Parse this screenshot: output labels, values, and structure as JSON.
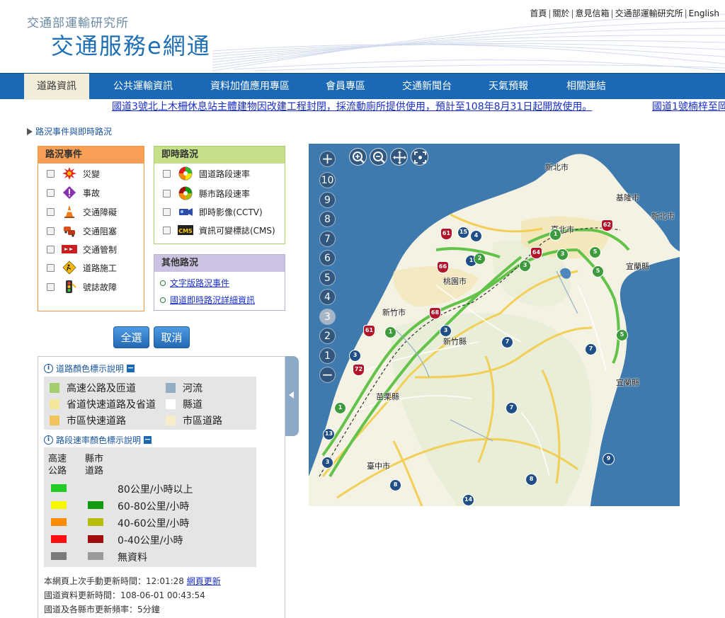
{
  "header": {
    "org_name": "交通部運輸研究所",
    "site_title": "交通服務e網通",
    "top_links": [
      "首頁",
      "關於",
      "意見信箱",
      "交通部運輸研究所",
      "English"
    ]
  },
  "nav": {
    "items": [
      "道路資訊",
      "公共運輸資訊",
      "資料加值應用專區",
      "會員專區",
      "交通新聞台",
      "天氣預報",
      "相關連結"
    ],
    "active": "道路資訊"
  },
  "marquee": {
    "items": [
      "國道3號北上木柵休息站主體建物因改建工程封閉，採流動廁所提供使用，預計至108年8月31日起開放使用。",
      "國道1號楠梓至岡"
    ]
  },
  "breadcrumb": "路況事件與即時路況",
  "incidents_panel": {
    "title": "路況事件",
    "items": [
      {
        "label": "災變",
        "icon": "disaster-icon"
      },
      {
        "label": "事故",
        "icon": "accident-icon"
      },
      {
        "label": "交通障礙",
        "icon": "traffic-cone-icon"
      },
      {
        "label": "交通阻塞",
        "icon": "congestion-icon"
      },
      {
        "label": "交通管制",
        "icon": "traffic-control-icon"
      },
      {
        "label": "道路施工",
        "icon": "road-work-icon"
      },
      {
        "label": "號誌故障",
        "icon": "signal-fault-icon"
      }
    ]
  },
  "realtime_panel": {
    "title": "即時路況",
    "items": [
      {
        "label": "國道路段速率",
        "icon": "freeway-speed-icon"
      },
      {
        "label": "縣市路段速率",
        "icon": "city-speed-icon"
      },
      {
        "label": "即時影像(CCTV)",
        "icon": "cctv-icon"
      },
      {
        "label": "資訊可變標誌(CMS)",
        "icon": "cms-icon",
        "icon_text": "CMS"
      }
    ]
  },
  "other_panel": {
    "title": "其他路況",
    "links": [
      "文字版路況事件",
      "國道即時路況詳細資訊"
    ]
  },
  "buttons": {
    "select_all": "全選",
    "cancel": "取消"
  },
  "road_color_legend": {
    "title": "道路顏色標示說明",
    "items": [
      {
        "label": "高速公路及匝道",
        "color": "#a4cd6e"
      },
      {
        "label": "河流",
        "color": "#93aec2"
      },
      {
        "label": "省道快速道路及省道",
        "color": "#f2e79a"
      },
      {
        "label": "縣道",
        "color": "#ffffff"
      },
      {
        "label": "市區快速道路",
        "color": "#f0c45a"
      },
      {
        "label": "市區道路",
        "color": "#f7ecc8"
      }
    ]
  },
  "speed_legend": {
    "title": "路段速率顏色標示說明",
    "col_freeway": [
      "高速",
      "公路"
    ],
    "col_city": [
      "縣市",
      "道路"
    ],
    "rows": [
      {
        "label": "80公里/小時以上",
        "freeway_color": "#22cc22",
        "city_color": null
      },
      {
        "label": "60-80公里/小時",
        "freeway_color": "#f7f700",
        "city_color": "#129a12"
      },
      {
        "label": "40-60公里/小時",
        "freeway_color": "#ff8c00",
        "city_color": "#b5bb08"
      },
      {
        "label": "0-40公里/小時",
        "freeway_color": "#ff1010",
        "city_color": "#a10d0d"
      },
      {
        "label": "無資料",
        "freeway_color": "#7a7a7a",
        "city_color": "#9a9a9a"
      }
    ]
  },
  "update_info": {
    "manual_refresh_label": "本網頁上次手動更新時間：12:01:28",
    "refresh_link": "網頁更新",
    "freeway_update": "國道資料更新時間：108-06-01 00:43:54",
    "frequency": "國道及各縣市更新頻率：5分鐘"
  },
  "map": {
    "zoom_levels": [
      "10",
      "9",
      "8",
      "7",
      "6",
      "5",
      "4",
      "3",
      "2",
      "1"
    ],
    "selected_zoom": "3",
    "tools": [
      "zoom-in-icon",
      "zoom-out-icon",
      "pan-icon",
      "full-extent-icon"
    ],
    "places": [
      "新北市",
      "基隆市",
      "新北市",
      "臺北市",
      "宜蘭縣",
      "桃園市",
      "新竹市",
      "新竹縣",
      "苗栗縣",
      "宜蘭縣",
      "臺中市"
    ],
    "route_shields": [
      "61",
      "15",
      "4",
      "1",
      "2",
      "64",
      "3",
      "62",
      "66",
      "68",
      "3",
      "1",
      "61",
      "3",
      "72",
      "1",
      "1",
      "7",
      "5",
      "7",
      "5",
      "7",
      "9",
      "13",
      "3",
      "8",
      "8",
      "14",
      "3",
      "5"
    ]
  }
}
